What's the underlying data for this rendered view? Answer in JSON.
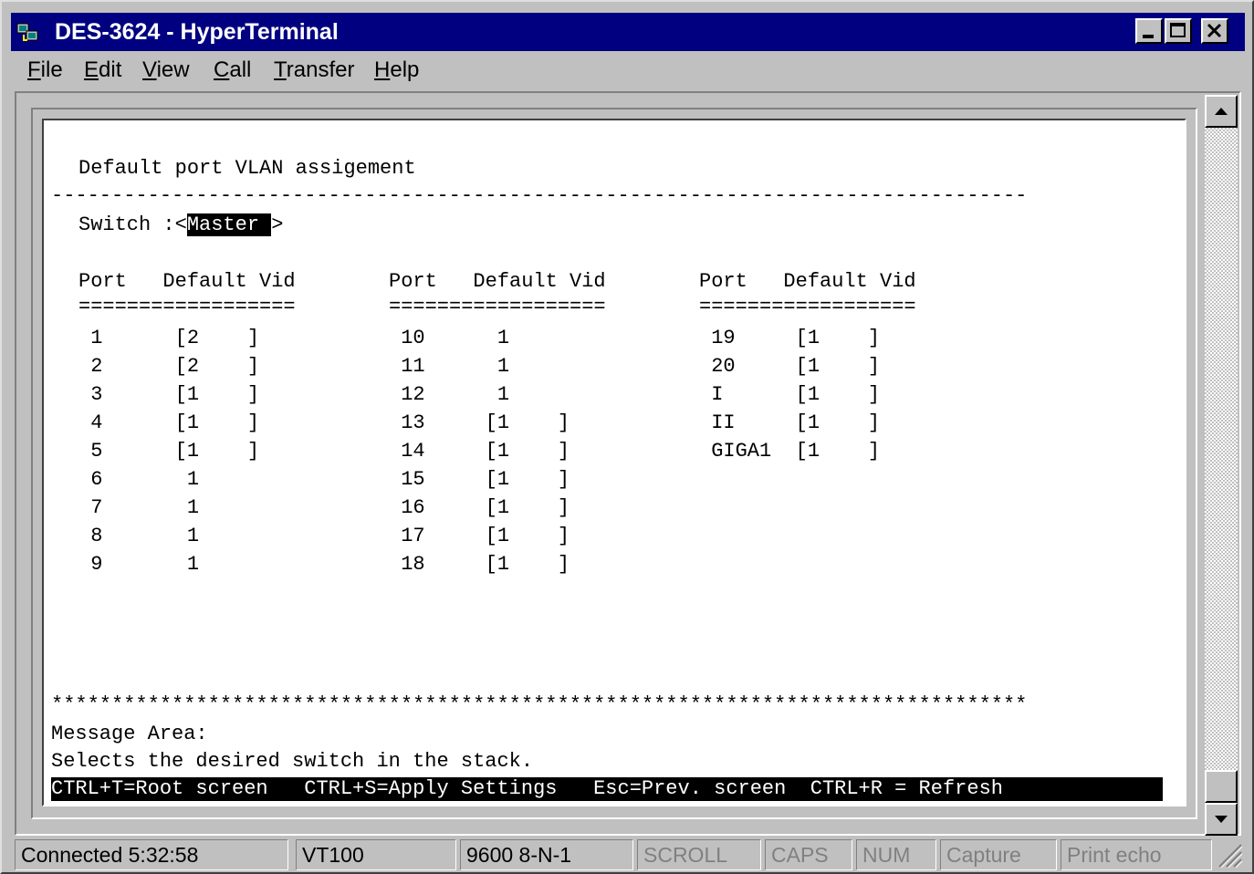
{
  "window": {
    "title": "DES-3624 - HyperTerminal"
  },
  "menu": [
    {
      "pre": "",
      "ul": "F",
      "post": "ile"
    },
    {
      "pre": "",
      "ul": "E",
      "post": "dit"
    },
    {
      "pre": "",
      "ul": "V",
      "post": "iew"
    },
    {
      "pre": "",
      "ul": "C",
      "post": "all"
    },
    {
      "pre": "",
      "ul": "T",
      "post": "ransfer"
    },
    {
      "pre": "",
      "ul": "H",
      "post": "elp"
    }
  ],
  "terminal": {
    "heading": "Default port VLAN assigement",
    "dash_rule": "---------------------------------------------------------------------------------",
    "switch_label": "Switch :<",
    "switch_value": "Master ",
    "switch_close": ">",
    "columns": [
      {
        "header": "Port   Default Vid",
        "rule": "=================="
      },
      {
        "header": "Port   Default Vid",
        "rule": "=================="
      },
      {
        "header": "Port   Default Vid",
        "rule": "=================="
      }
    ],
    "col1_rows": [
      " 1      [2    ]",
      " 2      [2    ]",
      " 3      [1    ]",
      " 4      [1    ]",
      " 5      [1    ]",
      " 6       1",
      " 7       1",
      " 8       1",
      " 9       1"
    ],
    "col2_rows": [
      " 10      1",
      " 11      1",
      " 12      1",
      " 13     [1    ]",
      " 14     [1    ]",
      " 15     [1    ]",
      " 16     [1    ]",
      " 17     [1    ]",
      " 18     [1    ]"
    ],
    "col3_rows": [
      " 19     [1    ]",
      " 20     [1    ]",
      " I      [1    ]",
      " II     [1    ]",
      " GIGA1  [1    ]"
    ],
    "star_rule": "*********************************************************************************",
    "message_label": "Message Area:",
    "message_text": "Selects the desired switch in the stack.",
    "hotkeys": "CTRL+T=Root screen   CTRL+S=Apply Settings   Esc=Prev. screen  CTRL+R = Refresh"
  },
  "status": {
    "connected": "Connected 5:32:58",
    "emulation": "VT100",
    "settings": "9600 8-N-1",
    "scroll": "SCROLL",
    "caps": "CAPS",
    "num": "NUM",
    "capture": "Capture",
    "print_echo": "Print echo"
  },
  "colors": {
    "titlebar": "#000080",
    "face": "#c0c0c0",
    "terminal_bg": "#ffffff",
    "highlight": "#000000"
  },
  "icons": [
    "hyperterminal-app-icon",
    "minimize-icon",
    "maximize-icon",
    "close-icon",
    "scroll-up-icon",
    "scroll-down-icon",
    "resize-grip-icon"
  ]
}
